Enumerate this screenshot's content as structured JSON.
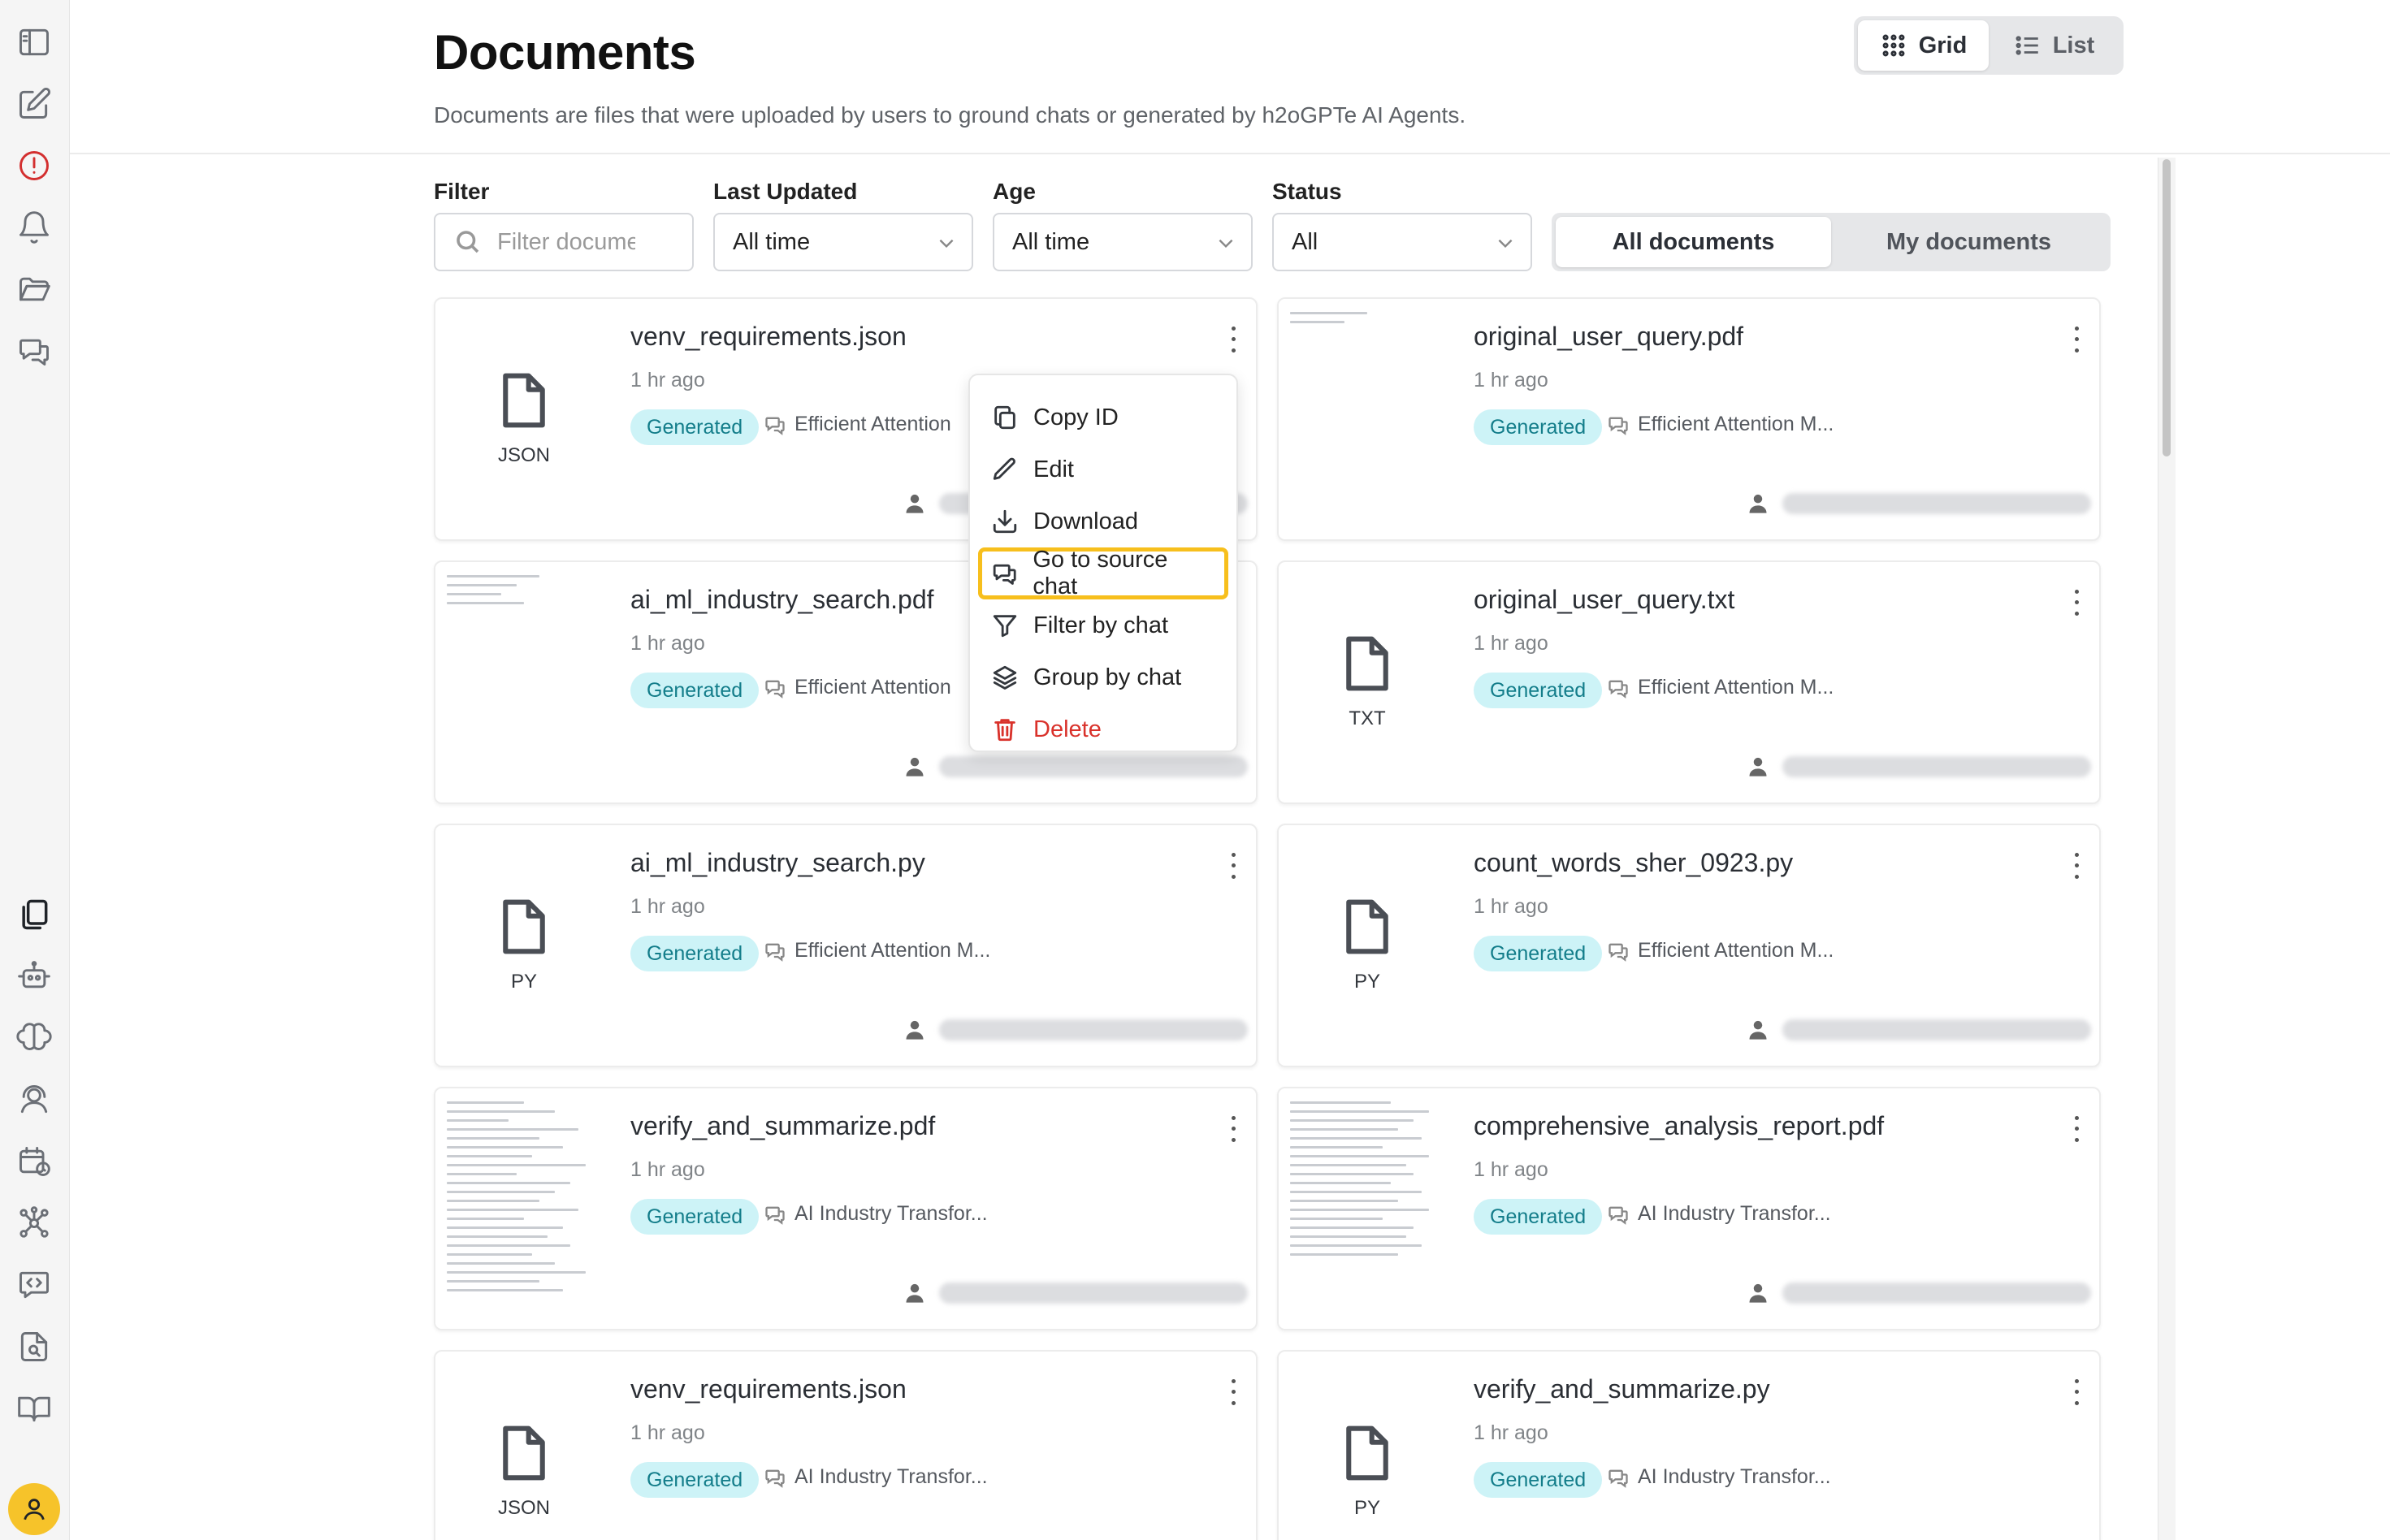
{
  "header": {
    "title": "Documents",
    "subtitle": "Documents are files that were uploaded by users to ground chats or generated by h2oGPTe AI Agents."
  },
  "view_toggle": {
    "grid_label": "Grid",
    "list_label": "List",
    "selected": "Grid"
  },
  "filters": {
    "filter_label": "Filter",
    "filter_placeholder": "Filter documents",
    "last_updated_label": "Last Updated",
    "last_updated_value": "All time",
    "age_label": "Age",
    "age_value": "All time",
    "status_label": "Status",
    "status_value": "All"
  },
  "scope_toggle": {
    "all_label": "All documents",
    "mine_label": "My documents",
    "selected": "All documents"
  },
  "documents": [
    {
      "title": "venv_requirements.json",
      "time": "1 hr ago",
      "badge": "Generated",
      "chat": "Efficient Attention",
      "ext": "JSON"
    },
    {
      "title": "original_user_query.pdf",
      "time": "1 hr ago",
      "badge": "Generated",
      "chat": "Efficient Attention M...",
      "ext": ""
    },
    {
      "title": "ai_ml_industry_search.pdf",
      "time": "1 hr ago",
      "badge": "Generated",
      "chat": "Efficient Attention",
      "ext": ""
    },
    {
      "title": "original_user_query.txt",
      "time": "1 hr ago",
      "badge": "Generated",
      "chat": "Efficient Attention M...",
      "ext": "TXT"
    },
    {
      "title": "ai_ml_industry_search.py",
      "time": "1 hr ago",
      "badge": "Generated",
      "chat": "Efficient Attention M...",
      "ext": "PY"
    },
    {
      "title": "count_words_sher_0923.py",
      "time": "1 hr ago",
      "badge": "Generated",
      "chat": "Efficient Attention M...",
      "ext": "PY"
    },
    {
      "title": "verify_and_summarize.pdf",
      "time": "1 hr ago",
      "badge": "Generated",
      "chat": "AI Industry Transfor...",
      "ext": ""
    },
    {
      "title": "comprehensive_analysis_report.pdf",
      "time": "1 hr ago",
      "badge": "Generated",
      "chat": "AI Industry Transfor...",
      "ext": ""
    },
    {
      "title": "venv_requirements.json",
      "time": "1 hr ago",
      "badge": "Generated",
      "chat": "AI Industry Transfor...",
      "ext": "JSON"
    },
    {
      "title": "verify_and_summarize.py",
      "time": "1 hr ago",
      "badge": "Generated",
      "chat": "AI Industry Transfor...",
      "ext": "PY"
    }
  ],
  "context_menu": {
    "items": [
      {
        "label": "Copy ID",
        "icon": "copy-icon"
      },
      {
        "label": "Edit",
        "icon": "pencil-icon"
      },
      {
        "label": "Download",
        "icon": "download-icon"
      },
      {
        "label": "Go to source chat",
        "icon": "chat-icon",
        "highlighted": true
      },
      {
        "label": "Filter by chat",
        "icon": "filter-icon"
      },
      {
        "label": "Group by chat",
        "icon": "layers-icon"
      },
      {
        "label": "Delete",
        "icon": "trash-icon",
        "danger": true
      }
    ]
  },
  "colors": {
    "badge_bg": "#cdf3f7",
    "badge_text": "#137d8a",
    "highlight": "#f7bf1d",
    "danger": "#d9322b",
    "avatar": "#f6c32a"
  }
}
